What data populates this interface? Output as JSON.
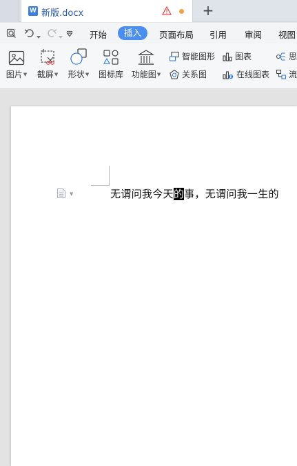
{
  "tabs": {
    "doc_title": "新版.docx",
    "doc_icon_letter": "W",
    "new_tab": "+"
  },
  "menu": {
    "items": [
      "开始",
      "插入",
      "页面布局",
      "引用",
      "审阅",
      "视图"
    ],
    "active": "插入"
  },
  "ribbon": {
    "picture": "图片",
    "screenshot": "截屏",
    "shape": "形状",
    "icon_lib": "图标库",
    "function_chart": "功能图",
    "smart_shape": "智能图形",
    "chart": "图表",
    "mind": "思",
    "relation": "关系图",
    "online_chart": "在线图表",
    "flow": "流"
  },
  "document": {
    "text_before": "无谓问我今天",
    "text_selected": "的",
    "text_after": "事，无谓问我一生的"
  },
  "colors": {
    "accent": "#4a8ef0",
    "tab_title": "#2a5db0",
    "warning": "#e04a4a",
    "unsaved_dot": "#f0a04b"
  }
}
